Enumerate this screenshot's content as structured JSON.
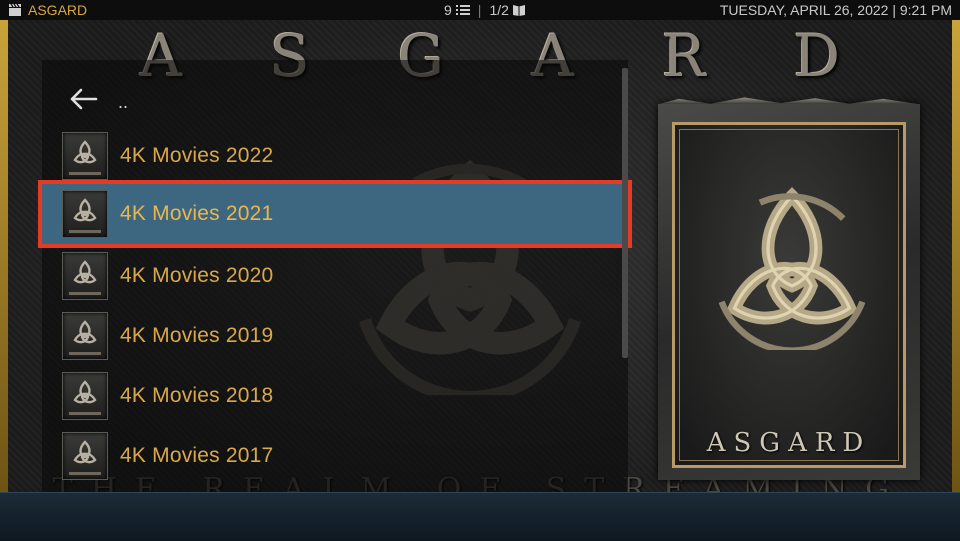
{
  "topbar": {
    "app_title": "ASGARD",
    "item_count": "9",
    "page": "1/2",
    "datetime": "TUESDAY, APRIL 26, 2022 | 9:21 PM",
    "icons": [
      "clapperboard-icon",
      "list-icon",
      "book-icon"
    ]
  },
  "background": {
    "title_letters": [
      "A",
      "S",
      "G",
      "A",
      "R",
      "D"
    ],
    "tagline": "THE REALM OF STREAMING"
  },
  "list": {
    "back_label": "..",
    "items": [
      {
        "label": "4K Movies 2022",
        "selected": false
      },
      {
        "label": "4K Movies 2021",
        "selected": true
      },
      {
        "label": "4K Movies 2020",
        "selected": false
      },
      {
        "label": "4K Movies 2019",
        "selected": false
      },
      {
        "label": "4K Movies 2018",
        "selected": false
      },
      {
        "label": "4K Movies 2017",
        "selected": false
      }
    ]
  },
  "poster": {
    "title": "ASGARD"
  },
  "colors": {
    "accent_gold": "#d9a84a",
    "selection_blue": "#3d6680",
    "selection_outline": "#e53a23"
  }
}
